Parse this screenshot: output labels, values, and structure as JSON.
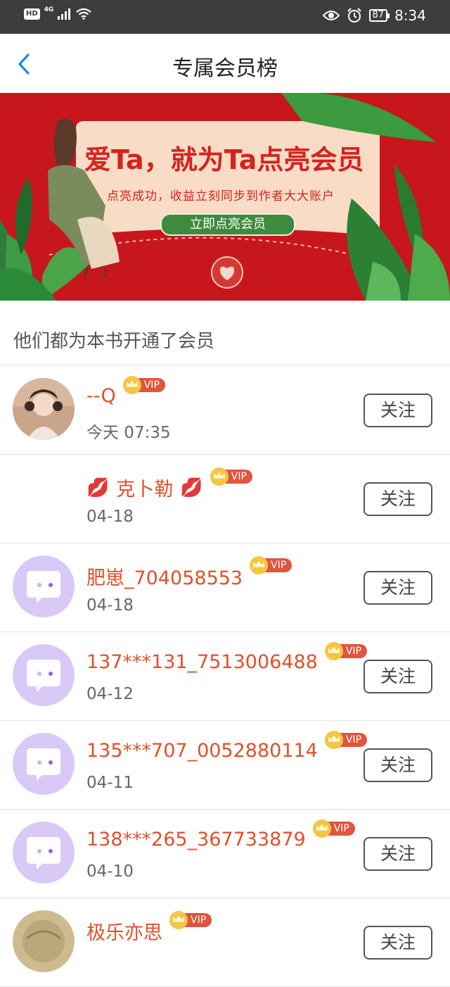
{
  "status_bar": {
    "hd": "HD",
    "network": "4G",
    "battery": "87",
    "time": "8:34"
  },
  "header": {
    "title": "专属会员榜"
  },
  "banner": {
    "headline": "爱Ta，就为Ta点亮会员",
    "subtitle": "点亮成功，收益立刻同步到作者大大账户",
    "button": "立即点亮会员"
  },
  "section_title": "他们都为本书开通了会员",
  "vip_label": "VIP",
  "follow_label": "关注",
  "members": [
    {
      "name": "--Q",
      "date": "今天 07:35",
      "avatar": "photo-girl"
    },
    {
      "name": "克卜勒",
      "date": "04-18",
      "avatar": "none",
      "decor": "💋"
    },
    {
      "name": "肥崽_704058553",
      "date": "04-18",
      "avatar": "chat-bubble"
    },
    {
      "name": "137***131_7513006488",
      "date": "04-12",
      "avatar": "chat-bubble"
    },
    {
      "name": "135***707_0052880114",
      "date": "04-11",
      "avatar": "chat-bubble"
    },
    {
      "name": "138***265_367733879",
      "date": "04-10",
      "avatar": "chat-bubble"
    },
    {
      "name": "极乐亦思",
      "date": "",
      "avatar": "photo-globe"
    }
  ],
  "colors": {
    "accent_blue": "#1e88e5",
    "name_red": "#e0502a",
    "vip_red": "#e0553e",
    "banner_red": "#c8161d",
    "avatar_purple": "#d9c9f7"
  }
}
